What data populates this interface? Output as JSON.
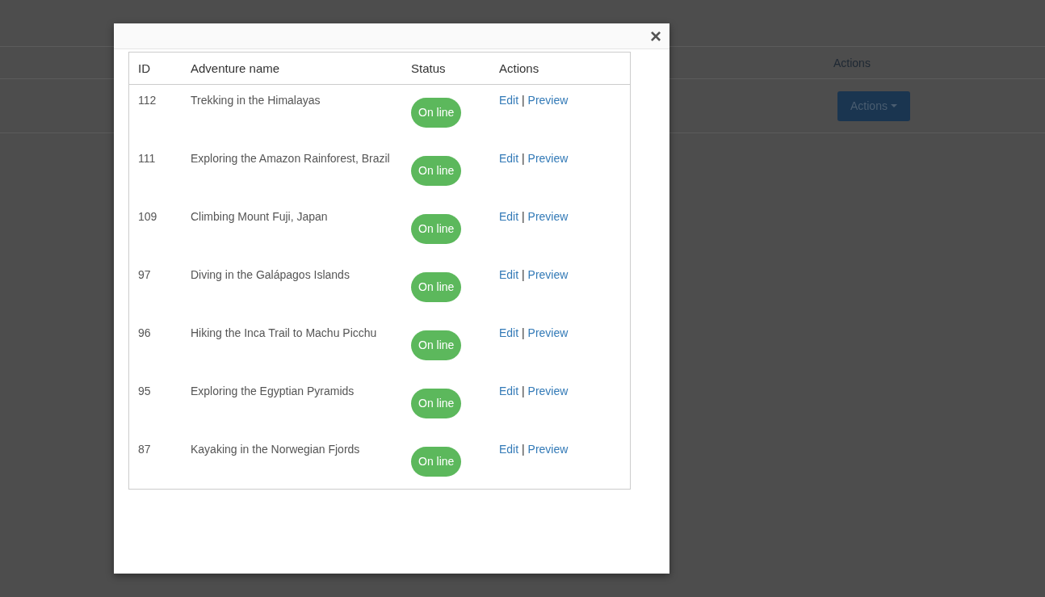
{
  "background_page": {
    "table_header": "Actions",
    "actions_button": "Actions"
  },
  "modal": {
    "close": "×",
    "table": {
      "columns": [
        "ID",
        "Adventure name",
        "Status",
        "Actions"
      ],
      "rows": [
        {
          "id": "112",
          "name": "Trekking in the Himalayas",
          "status": "On line",
          "kind": "online",
          "edit": "Edit",
          "separator": "|",
          "preview": "Preview"
        },
        {
          "id": "111",
          "name": "Exploring the Amazon Rainforest, Brazil",
          "status": "On line",
          "kind": "online",
          "edit": "Edit",
          "separator": "|",
          "preview": "Preview"
        },
        {
          "id": "109",
          "name": "Climbing Mount Fuji, Japan",
          "status": "On line",
          "kind": "online",
          "edit": "Edit",
          "separator": "|",
          "preview": "Preview"
        },
        {
          "id": "97",
          "name": "Diving in the Galápagos Islands",
          "status": "On line",
          "kind": "online",
          "edit": "Edit",
          "separator": "|",
          "preview": "Preview"
        },
        {
          "id": "96",
          "name": "Hiking the Inca Trail to Machu Picchu",
          "status": "On line",
          "kind": "online",
          "edit": "Edit",
          "separator": "|",
          "preview": "Preview"
        },
        {
          "id": "95",
          "name": "Exploring the Egyptian Pyramids",
          "status": "On line",
          "kind": "online",
          "edit": "Edit",
          "separator": "|",
          "preview": "Preview"
        },
        {
          "id": "87",
          "name": "Kayaking in the Norwegian Fjords",
          "status": "On line",
          "kind": "online",
          "edit": "Edit",
          "separator": "|",
          "preview": "Preview"
        }
      ]
    }
  }
}
